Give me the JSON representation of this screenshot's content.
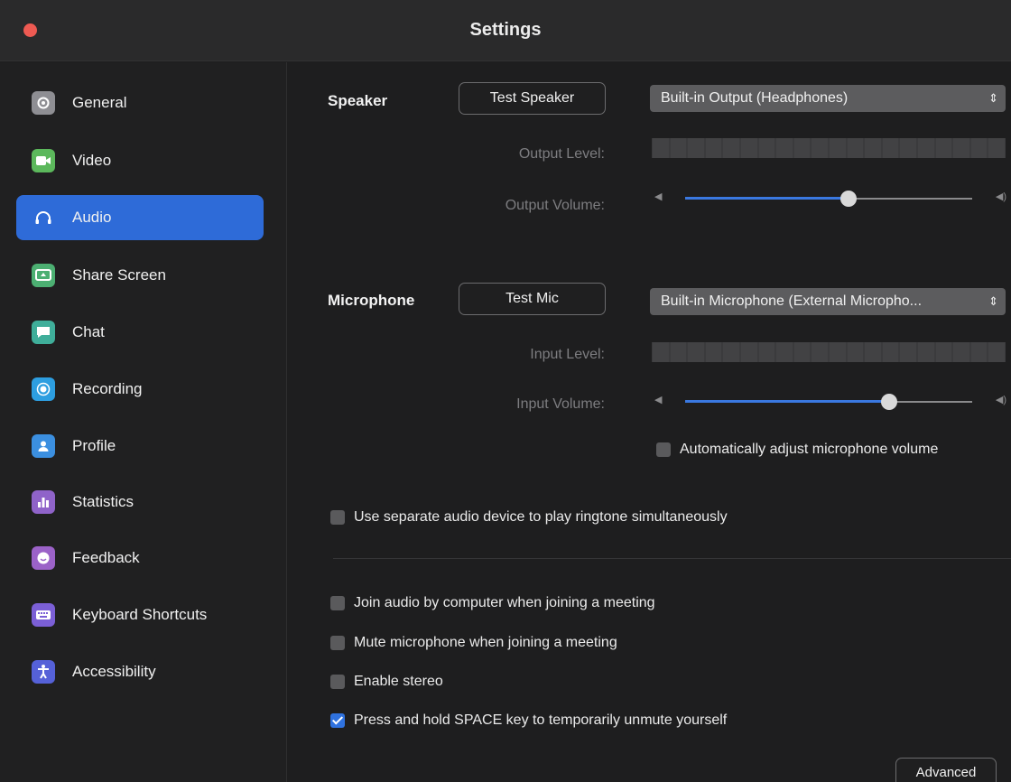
{
  "window": {
    "title": "Settings"
  },
  "sidebar": {
    "items": [
      {
        "label": "General",
        "icon": "gear-icon",
        "color": "#8e8e93",
        "active": false
      },
      {
        "label": "Video",
        "icon": "video-camera-icon",
        "color": "#5cb85c",
        "active": false
      },
      {
        "label": "Audio",
        "icon": "headphones-icon",
        "color": "#2e6bd8",
        "active": true
      },
      {
        "label": "Share Screen",
        "icon": "share-screen-icon",
        "color": "#4caf72",
        "active": false
      },
      {
        "label": "Chat",
        "icon": "chat-bubble-icon",
        "color": "#3fae9a",
        "active": false
      },
      {
        "label": "Recording",
        "icon": "recording-icon",
        "color": "#2d9ee0",
        "active": false
      },
      {
        "label": "Profile",
        "icon": "profile-icon",
        "color": "#3b8fe0",
        "active": false
      },
      {
        "label": "Statistics",
        "icon": "bar-chart-icon",
        "color": "#8f63c9",
        "active": false
      },
      {
        "label": "Feedback",
        "icon": "smiley-icon",
        "color": "#9b62c8",
        "active": false
      },
      {
        "label": "Keyboard Shortcuts",
        "icon": "keyboard-icon",
        "color": "#7b5fd6",
        "active": false
      },
      {
        "label": "Accessibility",
        "icon": "accessibility-icon",
        "color": "#5561d8",
        "active": false
      }
    ]
  },
  "speaker": {
    "label": "Speaker",
    "test_button": "Test Speaker",
    "device": "Built-in Output (Headphones)",
    "output_level_label": "Output Level:",
    "output_volume_label": "Output Volume:",
    "volume": 0.57
  },
  "microphone": {
    "label": "Microphone",
    "test_button": "Test Mic",
    "device": "Built-in Microphone (External Micropho...",
    "input_level_label": "Input Level:",
    "input_volume_label": "Input Volume:",
    "volume": 0.71,
    "auto_adjust_label": "Automatically adjust microphone volume",
    "auto_adjust_checked": false
  },
  "options": {
    "separate_device": {
      "label": "Use separate audio device to play ringtone simultaneously",
      "checked": false
    },
    "join_audio": {
      "label": "Join audio by computer when joining a meeting",
      "checked": false
    },
    "mute_mic": {
      "label": "Mute microphone when joining a meeting",
      "checked": false
    },
    "enable_stereo": {
      "label": "Enable stereo",
      "checked": false
    },
    "press_space": {
      "label": "Press and hold SPACE key to temporarily unmute yourself",
      "checked": true
    }
  },
  "advanced_button": "Advanced",
  "colors": {
    "accent": "#2e6bd8",
    "close": "#ee5a52"
  }
}
